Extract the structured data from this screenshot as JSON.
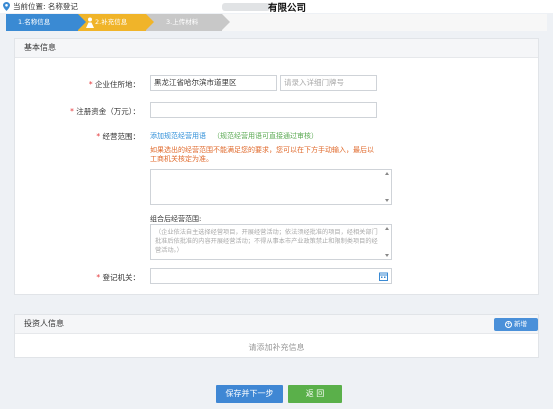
{
  "header": {
    "location_label": "当前位置: 名称登记",
    "company_suffix": "有限公司"
  },
  "steps": [
    {
      "label": "1.名称信息",
      "state": "done"
    },
    {
      "label": "2.补充信息",
      "state": "active"
    },
    {
      "label": "3.上传材料",
      "state": "pending"
    }
  ],
  "basic_info": {
    "title": "基本信息",
    "address": {
      "label": "企业住所地：",
      "value": "黑龙江省哈尔滨市道里区",
      "detail_placeholder": "请录入详细门牌号"
    },
    "capital": {
      "label": "注册资金（万元）：",
      "value": ""
    },
    "scope": {
      "label": "经营范围：",
      "add_link": "添加规范经营用语",
      "hint": "（规范经营用语可直接通过审核）",
      "warning": "如果选出的经营范围不能满足您的要求，您可以在下方手动输入，最后以工商机关核定为准。",
      "manual_value": "",
      "merged_label": "组合后经营范围:",
      "merged_text": "（企业依法自主选择经营项目，开展经营活动；依法须经批准的项目，经相关部门批准后依批准的内容开展经营活动；不得从事本市产业政策禁止和限制类项目的经营活动。）"
    },
    "authority": {
      "label": "登记机关：",
      "value": ""
    }
  },
  "investor_info": {
    "title": "投资人信息",
    "add_button": "新增",
    "empty_hint": "请添加补充信息"
  },
  "actions": {
    "save_next": "保存并下一步",
    "back": "返 回"
  },
  "colors": {
    "primary_blue": "#3a8ad3",
    "active_step": "#f0b429",
    "pending_step": "#c8c8c8",
    "back_green": "#5ab04a",
    "warning_orange": "#e06a2c"
  }
}
